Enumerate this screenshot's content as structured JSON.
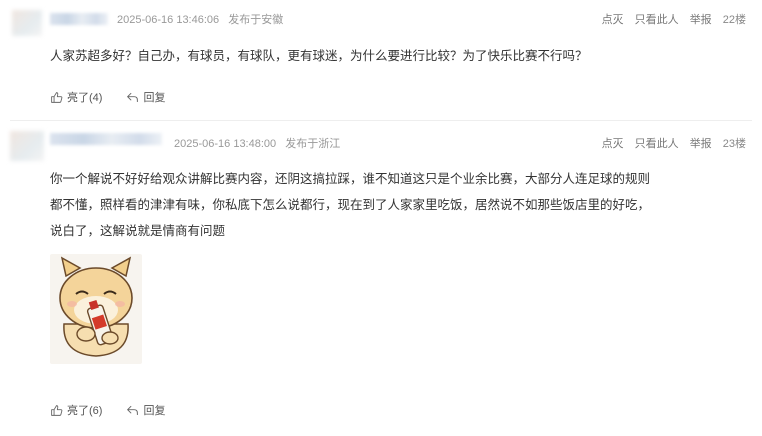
{
  "comments": [
    {
      "date": "2025-06-16 13:46:06",
      "location": "发布于安徽",
      "actions": {
        "report_light": "点灭",
        "only_this": "只看此人",
        "report": "举报"
      },
      "floor": "22楼",
      "text": [
        "人家苏超多好？自己办，有球员，有球队，更有球迷，为什么要进行比较？为了快乐比赛不行吗？"
      ],
      "like_label": "亮了(4)",
      "reply_label": "回复"
    },
    {
      "date": "2025-06-16 13:48:00",
      "location": "发布于浙江",
      "actions": {
        "report_light": "点灭",
        "only_this": "只看此人",
        "report": "举报"
      },
      "floor": "23楼",
      "text": [
        "你一个解说不好好给观众讲解比赛内容，还阴这搞拉踩，谁不知道这只是个业余比赛，大部分人连足球的规则",
        "都不懂，照样看的津津有味，你私底下怎么说都行，现在到了人家家里吃饭，居然说不如那些饭店里的好吃，",
        "说白了，这解说就是情商有问题"
      ],
      "like_label": "亮了(6)",
      "reply_label": "回复"
    }
  ]
}
